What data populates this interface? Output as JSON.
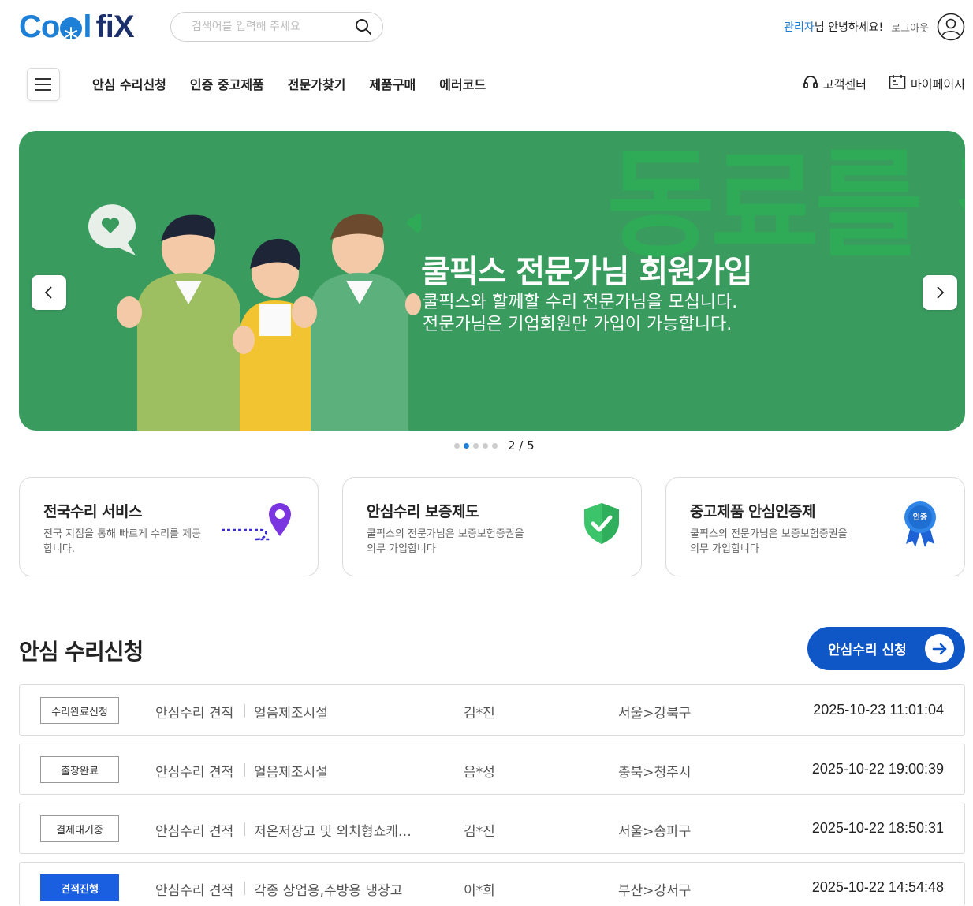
{
  "header": {
    "logo": {
      "part1": "Co",
      "part2": "l",
      "part3": "fiX"
    },
    "search": {
      "placeholder": "검색어를 입력해 주세요",
      "icon": "search-icon"
    },
    "user": {
      "admin_name": "관리자",
      "greeting": "님 안녕하세요!",
      "logout_label": "로그아웃",
      "icon": "user-icon"
    }
  },
  "nav": {
    "menu_icon": "hamburger-icon",
    "items": [
      "안심 수리신청",
      "인증 중고제품",
      "전문가찾기",
      "제품구매",
      "에러코드"
    ],
    "utilities": [
      {
        "label": "고객센터",
        "icon": "headset-icon"
      },
      {
        "label": "마이페이지",
        "icon": "calendar-icon"
      }
    ]
  },
  "banner": {
    "background_text": "동료를 찾습니다",
    "title": "쿨픽스 전문가님 회원가입",
    "subtitle_line1": "쿨픽스와 할께할 수리 전문가님을 모십니다.",
    "subtitle_line2": "전문가님은 기업회원만 가입이 가능합니다.",
    "bg_color": "#3a9b5f",
    "current_slide": 2,
    "total_slides": 5,
    "counter": "2 / 5"
  },
  "features": [
    {
      "title": "전국수리 서비스",
      "desc": "전국 지점을 통해 빠르게 수리를 제공합니다.",
      "icon": "location-pin-icon"
    },
    {
      "title": "안심수리 보증제도",
      "desc": "쿨픽스의 전문가님은 보증보험증권을 의무 가입합니다",
      "icon": "shield-check-icon"
    },
    {
      "title": "중고제품 안심인증제",
      "desc": "쿨픽스의 전문가님은 보증보험증권을 의무 가입합니다",
      "icon": "certified-badge-icon",
      "badge_text": "인증"
    }
  ],
  "repair_section": {
    "title": "안심 수리신청",
    "apply_label": "안심수리 신청",
    "accent_color": "#0f56c7",
    "rows": [
      {
        "status": "수리완료신청",
        "type": "안심수리 견적",
        "item": "얼음제조시설",
        "name": "김*진",
        "region": "서울>강북구",
        "date": "2025-10-23 11:01:04",
        "primary": false
      },
      {
        "status": "출장완료",
        "type": "안심수리 견적",
        "item": "얼음제조시설",
        "name": "음*성",
        "region": "충북>청주시",
        "date": "2025-10-22 19:00:39",
        "primary": false
      },
      {
        "status": "결제대기중",
        "type": "안심수리 견적",
        "item": "저온저장고 및 외치형쇼케이스",
        "name": "김*진",
        "region": "서울>송파구",
        "date": "2025-10-22 18:50:31",
        "primary": false
      },
      {
        "status": "견적진행",
        "type": "안심수리 견적",
        "item": "각종 상업용,주방용 냉장고",
        "name": "이*희",
        "region": "부산>강서구",
        "date": "2025-10-22 14:54:48",
        "primary": true
      }
    ]
  }
}
